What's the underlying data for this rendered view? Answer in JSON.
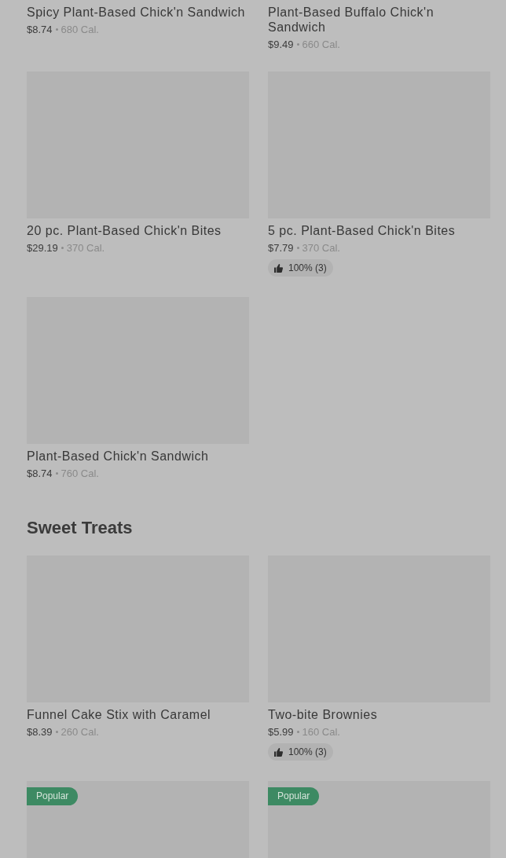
{
  "sections": [
    {
      "items": [
        {
          "name": "Spicy Plant-Based Chick'n Sandwich",
          "price": "$8.74",
          "calories": "680 Cal."
        },
        {
          "name": "Plant-Based Buffalo Chick'n Sandwich",
          "price": "$9.49",
          "calories": "660 Cal."
        },
        {
          "name": "20 pc. Plant-Based Chick'n Bites",
          "price": "$29.19",
          "calories": "370 Cal.",
          "show_image": true
        },
        {
          "name": "5 pc. Plant-Based Chick'n Bites",
          "price": "$7.79",
          "calories": "370 Cal.",
          "rating": "100% (3)",
          "show_image": true
        },
        {
          "name": "Plant-Based Chick'n Sandwich",
          "price": "$8.74",
          "calories": "760 Cal.",
          "show_image": true
        }
      ]
    },
    {
      "title": "Sweet Treats",
      "items": [
        {
          "name": "Funnel Cake Stix with Caramel",
          "price": "$8.39",
          "calories": "260 Cal.",
          "show_image": true
        },
        {
          "name": "Two-bite Brownies",
          "price": "$5.99",
          "calories": "160 Cal.",
          "rating": "100% (3)",
          "show_image": true
        },
        {
          "badge": "Popular",
          "show_image": true
        },
        {
          "badge": "Popular",
          "show_image": true
        }
      ]
    }
  ]
}
